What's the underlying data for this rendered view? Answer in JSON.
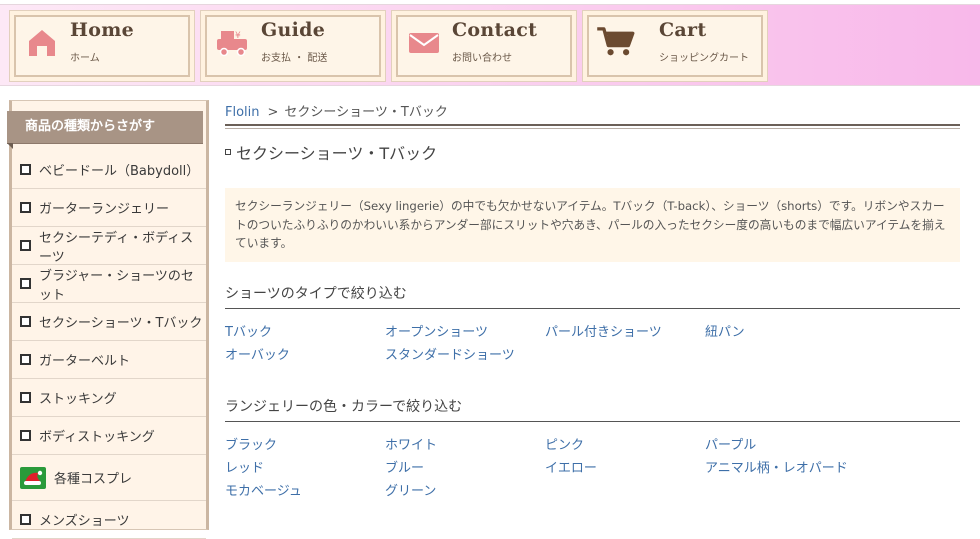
{
  "nav": [
    {
      "title": "Home",
      "sub": "ホーム",
      "icon": "house-icon"
    },
    {
      "title": "Guide",
      "sub": "お支払 ・ 配送",
      "icon": "delivery-truck-icon"
    },
    {
      "title": "Contact",
      "sub": "お問い合わせ",
      "icon": "envelope-icon"
    },
    {
      "title": "Cart",
      "sub": "ショッピングカート",
      "icon": "shopping-cart-icon"
    }
  ],
  "sidebar": {
    "heading": "商品の種類からさがす",
    "items": [
      {
        "label": "ベビードール（Babydoll）"
      },
      {
        "label": "ガーターランジェリー"
      },
      {
        "label": "セクシーテディ・ボディスーツ"
      },
      {
        "label": "ブラジャー・ショーツのセット"
      },
      {
        "label": "セクシーショーツ・Tバック"
      },
      {
        "label": "ガーターベルト"
      },
      {
        "label": "ストッキング"
      },
      {
        "label": "ボディストッキング"
      },
      {
        "label": "各種コスプレ",
        "icon": "santa-hat-icon"
      },
      {
        "label": "メンズショーツ"
      }
    ]
  },
  "breadcrumb": {
    "home": "Flolin",
    "separator": ">",
    "current": "セクシーショーツ・Tバック"
  },
  "page": {
    "title": "セクシーショーツ・Tバック",
    "description": "セクシーランジェリー（Sexy lingerie）の中でも欠かせないアイテム。Tバック（T-back）、ショーツ（shorts）です。リボンやスカートのついたふりふりのかわいい系からアンダー部にスリットや穴あき、パールの入ったセクシー度の高いものまで幅広いアイテムを揃えています。"
  },
  "filters": {
    "type": {
      "title": "ショーツのタイプで絞り込む",
      "links": [
        "Tバック",
        "オープンショーツ",
        "パール付きショーツ",
        "紐パン",
        "オーバック",
        "スタンダードショーツ"
      ]
    },
    "color": {
      "title": "ランジェリーの色・カラーで絞り込む",
      "links": [
        "ブラック",
        "ホワイト",
        "ピンク",
        "パープル",
        "レッド",
        "ブルー",
        "イエロー",
        "アニマル柄・レオパード",
        "モカベージュ",
        "グリーン"
      ]
    }
  },
  "colors": {
    "link": "#3e6fa8",
    "icon_accent": "#e8888c",
    "cart_icon": "#6b4a30"
  }
}
